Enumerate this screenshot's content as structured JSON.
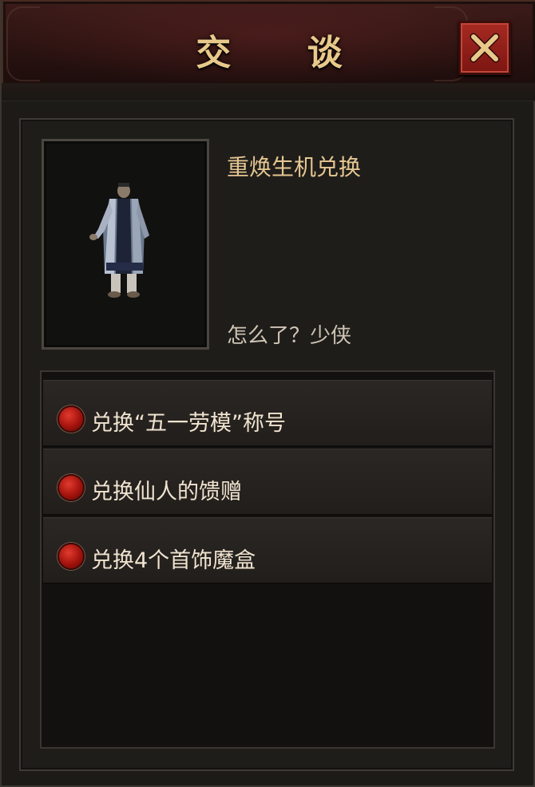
{
  "window": {
    "title": "交 谈",
    "close_icon": "close-x-icon"
  },
  "npc": {
    "name": "重焕生机兑换",
    "greeting": "怎么了？少侠",
    "portrait": "npc-portrait"
  },
  "options": [
    {
      "label": "兑换“五一劳模”称号",
      "icon": "red-dot-icon"
    },
    {
      "label": "兑换仙人的馈赠",
      "icon": "red-dot-icon"
    },
    {
      "label": "兑换4个首饰魔盒",
      "icon": "red-dot-icon"
    }
  ],
  "colors": {
    "title": "#e8c98a",
    "npc_name": "#e6c792",
    "close_button": "#a62a22",
    "option_dot": "#c0201a"
  }
}
